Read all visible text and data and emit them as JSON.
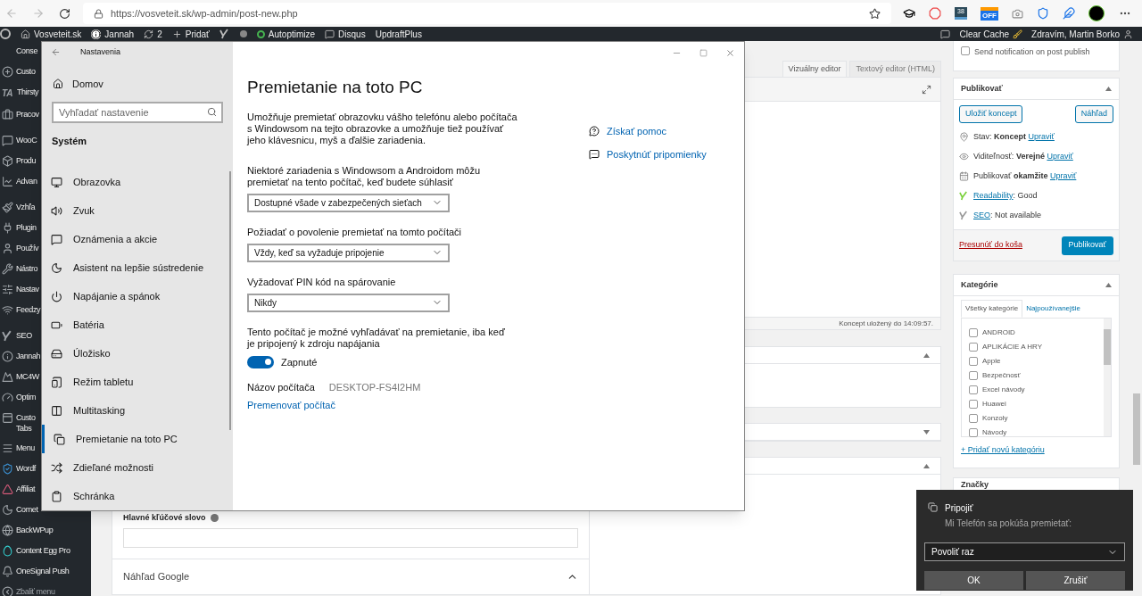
{
  "browser": {
    "url": "https://vosveteit.sk/wp-admin/post-new.php",
    "extensions": [
      {
        "kind": "hat"
      },
      {
        "kind": "stop"
      },
      {
        "kind": "calendar",
        "text": "38"
      },
      {
        "kind": "tag",
        "text": "OFF"
      },
      {
        "kind": "camera"
      },
      {
        "kind": "shield"
      },
      {
        "kind": "feather"
      },
      {
        "kind": "avatar"
      }
    ]
  },
  "admin_bar": {
    "left": [
      {
        "kind": "logo"
      },
      {
        "kind": "home",
        "label": "Vosveteit.sk"
      },
      {
        "kind": "info",
        "label": "Jannah"
      },
      {
        "kind": "updates",
        "label": "2"
      },
      {
        "kind": "plus",
        "label": "Pridať"
      },
      {
        "kind": "seo"
      },
      {
        "kind": "dot"
      },
      {
        "kind": "ring",
        "label": "Autoptimize"
      },
      {
        "kind": "comment",
        "label": "Disqus"
      },
      {
        "kind": "text",
        "label": "UpdraftPlus"
      }
    ],
    "right": [
      {
        "kind": "comment"
      },
      {
        "kind": "broom",
        "label": "Clear Cache"
      },
      {
        "kind": "user",
        "label": "Zdravím, Martin Borko"
      }
    ]
  },
  "wp_sidebar": [
    [
      {
        "kind": "none",
        "label": "Conse"
      },
      {
        "kind": "plus-circle",
        "label": "Custo"
      },
      {
        "kind": "glyph",
        "glyph": "TA",
        "label": "Thirsty"
      },
      {
        "kind": "briefcase",
        "label": "Pracov"
      }
    ],
    [
      {
        "kind": "bubble",
        "label": "WooC"
      },
      {
        "kind": "cube",
        "label": "Produ"
      },
      {
        "kind": "chart",
        "label": "Advan"
      }
    ],
    [
      {
        "kind": "brush",
        "label": "Vzhľa"
      },
      {
        "kind": "plug",
        "label": "Plugin"
      },
      {
        "kind": "user",
        "label": "Použív"
      },
      {
        "kind": "wrench",
        "label": "Nástro"
      },
      {
        "kind": "sliders",
        "label": "Nastav"
      },
      {
        "kind": "wifi",
        "label": "Feedzy"
      }
    ],
    [
      {
        "kind": "logo",
        "label": "SEO"
      },
      {
        "kind": "info",
        "label": "Jannah"
      },
      {
        "kind": "mountain",
        "label": "MC4W"
      },
      {
        "kind": "gauge",
        "label": "Optim"
      },
      {
        "kind": "panel",
        "label": "Custo",
        "second_line": "Tabs"
      },
      {
        "kind": "menu",
        "label": "Menu"
      },
      {
        "kind": "shield",
        "label": "Wordf"
      },
      {
        "kind": "triangle",
        "label": "Affiliat"
      },
      {
        "kind": "crescent",
        "label": "Comet"
      },
      {
        "kind": "globe",
        "label": "BackWPup"
      },
      {
        "kind": "egg",
        "label": "Content Egg Pro"
      },
      {
        "kind": "bell",
        "label": "OneSignal Push"
      },
      {
        "kind": "collapse",
        "label": "Zbaliť menu"
      }
    ]
  ],
  "editor": {
    "tabs": [
      {
        "label": "Vizuálny editor",
        "selected": true
      },
      {
        "label": "Textový editor (HTML)",
        "selected": false
      }
    ],
    "status": "Koncept uložený do 14:09:57.",
    "boxes": [
      {
        "expanded": true
      },
      {
        "expanded": false
      },
      {
        "expanded": true
      }
    ],
    "yoast": {
      "keyword_label": "Hlavné kľúčové slovo",
      "preview_label": "Náhľad Google",
      "preview_expanded": true
    }
  },
  "notification": {
    "label": "Send notification on post publish",
    "checked": false
  },
  "publish": {
    "title": "Publikovať",
    "save_draft": "Uložiť koncept",
    "preview": "Náhľad",
    "rows": [
      {
        "kind": "pin",
        "text": "Stav: **Koncept** ",
        "link_after": "Upraviť"
      },
      {
        "kind": "eye",
        "text": "Viditeľnosť: **Verejné** ",
        "link_after": "Upraviť"
      },
      {
        "kind": "calendar",
        "text": "Publikovať **okamžite** ",
        "link_after": "Upraviť"
      },
      {
        "kind": "logo",
        "color": "#7ad03a",
        "link_before": "Readability",
        "text": ": Good"
      },
      {
        "kind": "logo",
        "color": "#999999",
        "link_before": "SEO",
        "text": ": Not available"
      }
    ],
    "trash": "Presunúť do koša",
    "button": "Publikovať",
    "expanded": true
  },
  "categories": {
    "title": "Kategórie",
    "tabs": [
      {
        "label": "Všetky kategórie",
        "selected": true
      },
      {
        "label": "Najpoužívanejšie",
        "selected": false
      }
    ],
    "items": [
      {
        "label": "ANDROID",
        "checked": false
      },
      {
        "label": "APLIKÁCIE A HRY",
        "checked": false
      },
      {
        "label": "Apple",
        "checked": false
      },
      {
        "label": "Bezpečnosť",
        "checked": false
      },
      {
        "label": "Excel návody",
        "checked": false
      },
      {
        "label": "Huawei",
        "checked": false
      },
      {
        "label": "Konzoly",
        "checked": false
      },
      {
        "label": "Návody",
        "checked": false
      }
    ],
    "add": "+ Pridať novú kategóriu",
    "expanded": true
  },
  "tags": {
    "title": "Značky"
  },
  "settings": {
    "title": "Nastavenia",
    "home": "Domov",
    "search_placeholder": "Vyhľadať nastavenie",
    "section": "Systém",
    "nav": [
      {
        "kind": "monitor",
        "label": "Obrazovka",
        "selected": false
      },
      {
        "kind": "sound",
        "label": "Zvuk",
        "selected": false
      },
      {
        "kind": "message",
        "label": "Oznámenia a akcie",
        "selected": false
      },
      {
        "kind": "moon",
        "label": "Asistent na lepšie sústredenie",
        "selected": false
      },
      {
        "kind": "power",
        "label": "Napájanie a spánok",
        "selected": false
      },
      {
        "kind": "battery",
        "label": "Batéria",
        "selected": false
      },
      {
        "kind": "storage",
        "label": "Úložisko",
        "selected": false
      },
      {
        "kind": "tablet",
        "label": "Režim tabletu",
        "selected": false
      },
      {
        "kind": "columns",
        "label": "Multitasking",
        "selected": false
      },
      {
        "kind": "screens",
        "label": "Premietanie na toto PC",
        "selected": true
      },
      {
        "kind": "shuffle",
        "label": "Zdieľané možnosti",
        "selected": false
      },
      {
        "kind": "clipboard",
        "label": "Schránka",
        "selected": false
      }
    ],
    "page": {
      "title": "Premietanie na toto PC",
      "description": "Umožňuje premietať obrazovku vášho telefónu alebo počítača s Windowsom na tejto obrazovke a umožňuje tiež používať jeho klávesnicu, myš a ďalšie zariadenia.",
      "controls": [
        {
          "kind": "dropdown",
          "label": "Niektoré zariadenia s Windowsom a Androidom môžu premietať na tento počítač, keď budete súhlasiť",
          "value": "Dostupné všade v zabezpečených sieťach"
        },
        {
          "kind": "dropdown",
          "label": "Požiadať o povolenie premietať na tomto počítači",
          "value": "Vždy, keď sa vyžaduje pripojenie"
        },
        {
          "kind": "dropdown",
          "label": "Vyžadovať PIN kód na spárovanie",
          "value": "Nikdy"
        },
        {
          "kind": "toggle",
          "label": "Tento počítač je možné vyhľadávať na premietanie, iba keď je pripojený k zdroju napájania",
          "on": true,
          "state_text": "Zapnuté"
        },
        {
          "kind": "name",
          "label": "Názov počítača",
          "value": "DESKTOP-FS4I2HM"
        },
        {
          "kind": "link",
          "label": "Premenovať počítač"
        }
      ],
      "help_links": [
        {
          "kind": "help",
          "label": "Získať pomoc"
        },
        {
          "kind": "feedback",
          "label": "Poskytnúť pripomienky"
        }
      ]
    }
  },
  "toast": {
    "title": "Pripojiť",
    "message": "Mi Telefón sa pokúša premietať:",
    "select": "Povoliť raz",
    "buttons": [
      "OK",
      "Zrušiť"
    ]
  }
}
